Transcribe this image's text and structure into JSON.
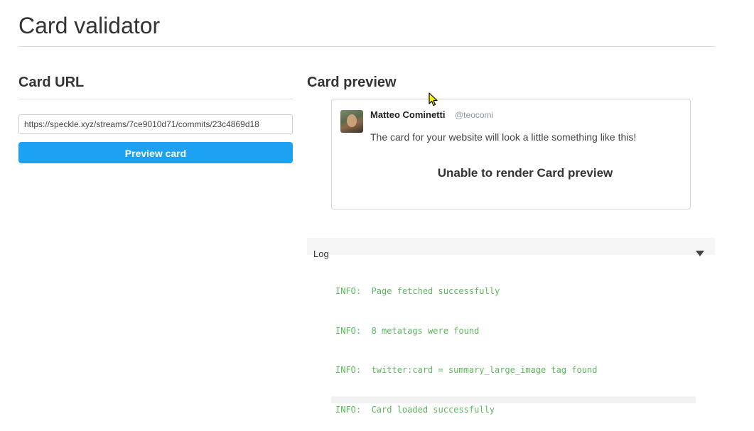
{
  "header": {
    "title": "Card validator"
  },
  "url_section": {
    "title": "Card URL",
    "input_value": "https://speckle.xyz/streams/7ce9010d71/commits/23c4869d18",
    "button_label": "Preview card"
  },
  "preview_section": {
    "title": "Card preview",
    "author_name": "Matteo Cominetti",
    "author_handle": "@teocomi",
    "tweet_text": "The card for your website will look a little something like this!",
    "render_message": "Unable to render Card preview"
  },
  "log": {
    "label": "Log",
    "lines": [
      "INFO:  Page fetched successfully",
      "INFO:  8 metatags were found",
      "INFO:  twitter:card = summary_large_image tag found",
      "INFO:  Card loaded successfully"
    ]
  },
  "colors": {
    "accent": "#1da1f2",
    "log_text": "#5cb85c",
    "handle": "#8899a6"
  },
  "icons": {
    "avatar": "user-avatar",
    "log_toggle": "caret-down-icon",
    "cursor": "mouse-pointer-icon"
  }
}
